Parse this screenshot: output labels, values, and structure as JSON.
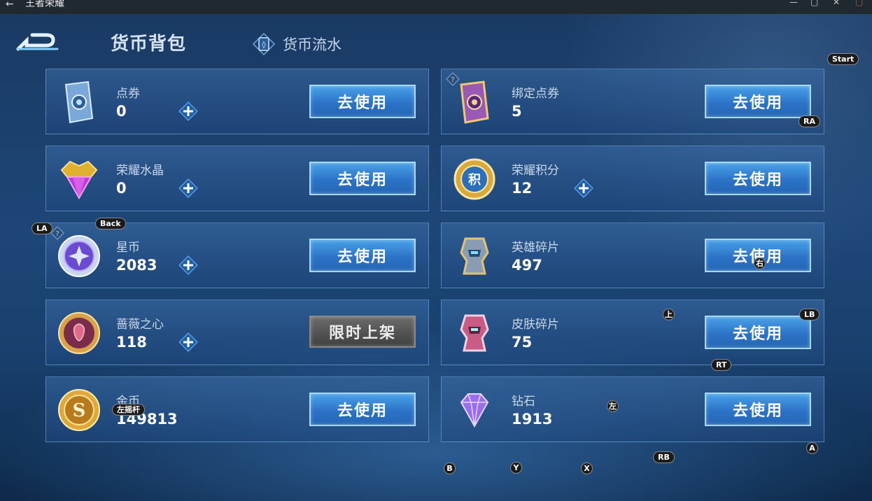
{
  "window": {
    "title": "王者荣耀",
    "back": "←",
    "min": "—",
    "max": "▢",
    "close": "✕",
    "extra": "▢"
  },
  "header": {
    "active_tab": "货币背包",
    "flow_tab": "货币流水"
  },
  "currencies": [
    {
      "name": "点券",
      "amount": "0",
      "action": "去使用"
    },
    {
      "name": "绑定点券",
      "amount": "5",
      "action": "去使用"
    },
    {
      "name": "荣耀水晶",
      "amount": "0",
      "action": "去使用"
    },
    {
      "name": "荣耀积分",
      "amount": "12",
      "action": "去使用"
    },
    {
      "name": "星币",
      "amount": "2083",
      "action": "去使用"
    },
    {
      "name": "英雄碎片",
      "amount": "497",
      "action": "去使用"
    },
    {
      "name": "蔷薇之心",
      "amount": "118",
      "action": "限时上架"
    },
    {
      "name": "皮肤碎片",
      "amount": "75",
      "action": "去使用"
    },
    {
      "name": "金币",
      "amount": "149813",
      "action": "去使用"
    },
    {
      "name": "钻石",
      "amount": "1913",
      "action": "去使用"
    }
  ],
  "icons": {
    "coupon": "blue-card-icon",
    "bound_coupon": "purple-card-icon",
    "crystal": "crystal-icon",
    "points": "glory-points-icon",
    "star": "star-coin-icon",
    "hero_shard": "hero-shard-icon",
    "rose": "rose-heart-icon",
    "skin_shard": "skin-shard-icon",
    "gold": "gold-coin-icon",
    "diamond": "diamond-icon"
  },
  "overlay": {
    "start": "Start",
    "ra": "RA",
    "la": "LA",
    "back": "Back",
    "right": "右",
    "up": "上",
    "lb": "LB",
    "rt": "RT",
    "left_stick": "左摇杆",
    "left": "左",
    "a": "A",
    "rb": "RB",
    "b": "B",
    "y": "Y",
    "x": "X"
  },
  "colors": {
    "button_blue": "#2c73c7",
    "button_gray": "#4f4f4f",
    "panel": "#1d4677"
  }
}
